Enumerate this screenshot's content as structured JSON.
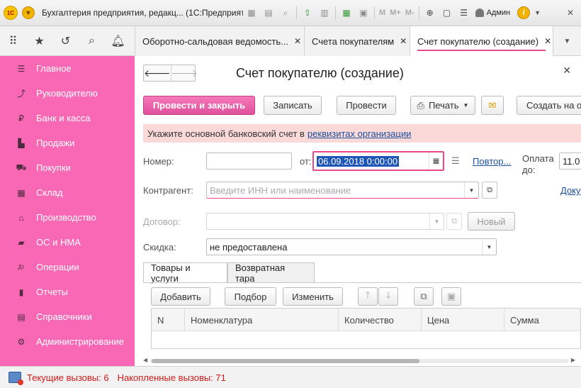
{
  "window": {
    "title": "Бухгалтерия предприятия, редакц... (1С:Предприятие)",
    "user": "Админ",
    "toolbar_text": [
      "M",
      "M+",
      "M-"
    ]
  },
  "quick_panel": {
    "icons": [
      "apps-icon",
      "star-icon",
      "history-icon",
      "search-icon",
      "bell-icon"
    ]
  },
  "tabs": [
    {
      "label": "Оборотно-сальдовая ведомость..."
    },
    {
      "label": "Счета покупателям"
    },
    {
      "label": "Счет покупателю (создание)"
    }
  ],
  "sidebar": {
    "items": [
      {
        "label": "Главное",
        "icon": "menu-icon"
      },
      {
        "label": "Руководителю",
        "icon": "trend-icon"
      },
      {
        "label": "Банк и касса",
        "icon": "ruble-icon"
      },
      {
        "label": "Продажи",
        "icon": "bag-icon"
      },
      {
        "label": "Покупки",
        "icon": "cart-icon"
      },
      {
        "label": "Склад",
        "icon": "warehouse-icon"
      },
      {
        "label": "Производство",
        "icon": "factory-icon"
      },
      {
        "label": "ОС и НМА",
        "icon": "truck-icon"
      },
      {
        "label": "Операции",
        "icon": "dt-kt-icon"
      },
      {
        "label": "Отчеты",
        "icon": "chart-icon"
      },
      {
        "label": "Справочники",
        "icon": "book-icon"
      },
      {
        "label": "Администрирование",
        "icon": "gear-icon"
      }
    ]
  },
  "form": {
    "title": "Счет покупателю (создание)",
    "buttons": {
      "post_close": "Провести и закрыть",
      "save": "Записать",
      "post": "Провести",
      "print": "Печать",
      "create_based": "Создать на о"
    },
    "warning": {
      "text": "Укажите основной банковский счет в",
      "link": "реквизитах организации"
    },
    "fields": {
      "number_label": "Номер:",
      "number_value": "",
      "from_label": "от:",
      "date_value": "06.09.2018  0:00:00",
      "repeat_link": "Повтор...",
      "payment_label_1": "Оплата",
      "payment_label_2": "до:",
      "payment_value": "11.0",
      "counterparty_label": "Контрагент:",
      "counterparty_placeholder": "Введите ИНН или наименование",
      "doc_link": "Доку",
      "contract_label": "Договор:",
      "contract_value": "",
      "new_button": "Новый",
      "discount_label": "Скидка:",
      "discount_value": "не предоставлена"
    },
    "tabs": [
      {
        "label": "Товары и услуги"
      },
      {
        "label": "Возвратная тара"
      }
    ],
    "table_buttons": {
      "add": "Добавить",
      "select": "Подбор",
      "edit": "Изменить"
    },
    "table": {
      "columns": [
        "N",
        "Номенклатура",
        "Количество",
        "Цена",
        "Сумма"
      ],
      "rows": []
    }
  },
  "status": {
    "current_calls": "Текущие вызовы: 6",
    "accumulated_calls": "Накопленные вызовы: 71"
  },
  "colors": {
    "accent": "#f968b4",
    "primary_button": "#e0509d",
    "warning_bg": "#fbd9d9",
    "link": "#1a4f9c",
    "status_text": "#d31818"
  }
}
